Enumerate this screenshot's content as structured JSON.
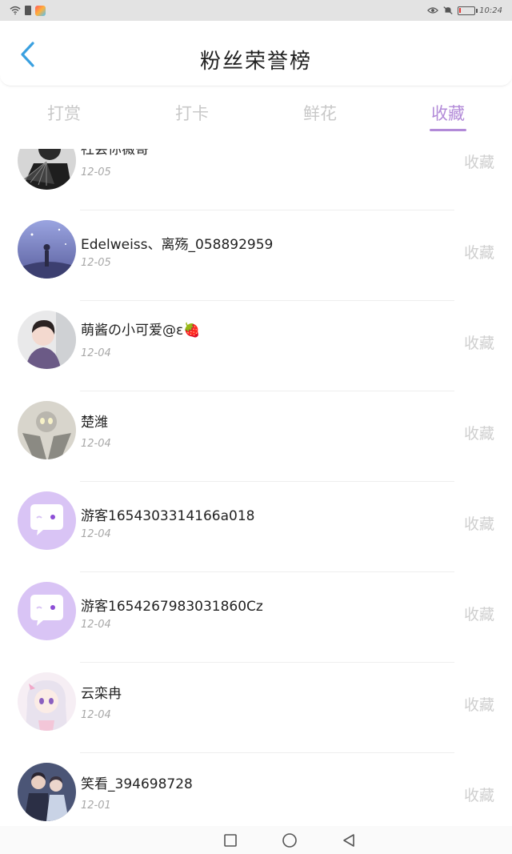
{
  "status_bar": {
    "time": "10:24",
    "battery_percent": 10
  },
  "header": {
    "title": "粉丝荣誉榜"
  },
  "tabs": [
    {
      "label": "打赏",
      "active": false
    },
    {
      "label": "打卡",
      "active": false
    },
    {
      "label": "鲜花",
      "active": false
    },
    {
      "label": "收藏",
      "active": true
    }
  ],
  "list": {
    "items": [
      {
        "name": "社会你薇哥",
        "date": "12-05",
        "action": "收藏",
        "avatar": "dark-fan-photo"
      },
      {
        "name": "Edelweiss、离殇_058892959",
        "date": "12-05",
        "action": "收藏",
        "avatar": "purple-sky-photo"
      },
      {
        "name": "萌酱の小可爱@ε🍓",
        "date": "12-04",
        "action": "收藏",
        "avatar": "child-photo"
      },
      {
        "name": "楚潍",
        "date": "12-04",
        "action": "收藏",
        "avatar": "ultraman-photo"
      },
      {
        "name": "游客1654303314166a018",
        "date": "12-04",
        "action": "收藏",
        "avatar": "default-chat-avatar"
      },
      {
        "name": "游客1654267983031860Cz",
        "date": "12-04",
        "action": "收藏",
        "avatar": "default-chat-avatar"
      },
      {
        "name": "云栾冉",
        "date": "12-04",
        "action": "收藏",
        "avatar": "anime-girl-photo"
      },
      {
        "name": "笑看_394698728",
        "date": "12-01",
        "action": "收藏",
        "avatar": "couple-photo"
      }
    ]
  },
  "colors": {
    "accent": "#b28ad8",
    "back_arrow": "#3aa0e0",
    "default_avatar_bg": "#d9c4f5"
  }
}
